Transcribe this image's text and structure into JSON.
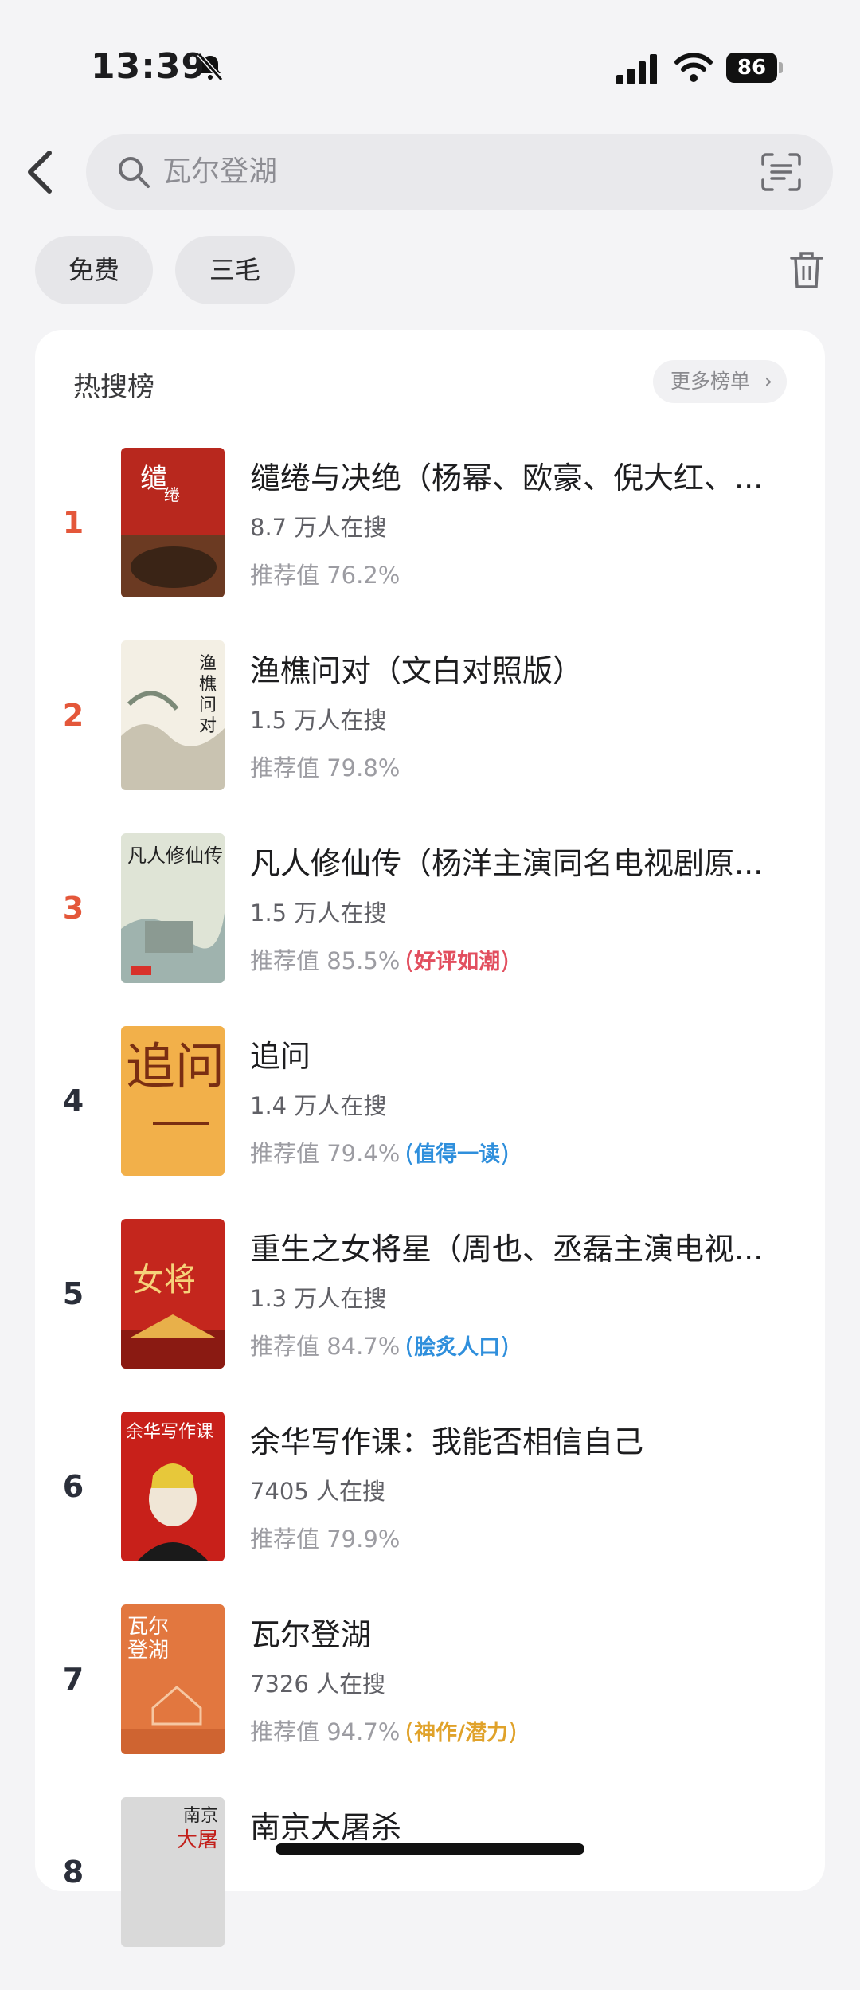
{
  "status_bar": {
    "time": "13:39",
    "battery": "86"
  },
  "search": {
    "query": "瓦尔登湖"
  },
  "chips": [
    "免费",
    "三毛"
  ],
  "hot_list": {
    "title": "热搜榜",
    "more_label": "更多榜单",
    "items": [
      {
        "rank": "1",
        "title": "缱绻与决绝（杨幂、欧豪、倪大红、...",
        "searches": "8.7 万人在搜",
        "rec": "推荐值 76.2%",
        "badge": "",
        "badge_color": ""
      },
      {
        "rank": "2",
        "title": "渔樵问对（文白对照版）",
        "searches": "1.5 万人在搜",
        "rec": "推荐值 79.8%",
        "badge": "",
        "badge_color": ""
      },
      {
        "rank": "3",
        "title": "凡人修仙传（杨洋主演同名电视剧原...",
        "searches": "1.5 万人在搜",
        "rec": "推荐值 85.5%",
        "badge": "好评如潮",
        "badge_color": "#e24f5f"
      },
      {
        "rank": "4",
        "title": "追问",
        "searches": "1.4 万人在搜",
        "rec": "推荐值 79.4%",
        "badge": "值得一读",
        "badge_color": "#2f8fdc"
      },
      {
        "rank": "5",
        "title": "重生之女将星（周也、丞磊主演电视...",
        "searches": "1.3 万人在搜",
        "rec": "推荐值 84.7%",
        "badge": "脍炙人口",
        "badge_color": "#2f8fdc"
      },
      {
        "rank": "6",
        "title": "余华写作课：我能否相信自己",
        "searches": "7405 人在搜",
        "rec": "推荐值 79.9%",
        "badge": "",
        "badge_color": ""
      },
      {
        "rank": "7",
        "title": "瓦尔登湖",
        "searches": "7326 人在搜",
        "rec": "推荐值 94.7%",
        "badge": "神作/潜力",
        "badge_color": "#e0a22a"
      },
      {
        "rank": "8",
        "title": "南京大屠杀",
        "searches": "",
        "rec": "",
        "badge": "",
        "badge_color": ""
      }
    ]
  },
  "colors": {
    "hot_rank": "#e4573a",
    "normal_rank": "#2b2f3a",
    "background": "#f4f4f6"
  }
}
